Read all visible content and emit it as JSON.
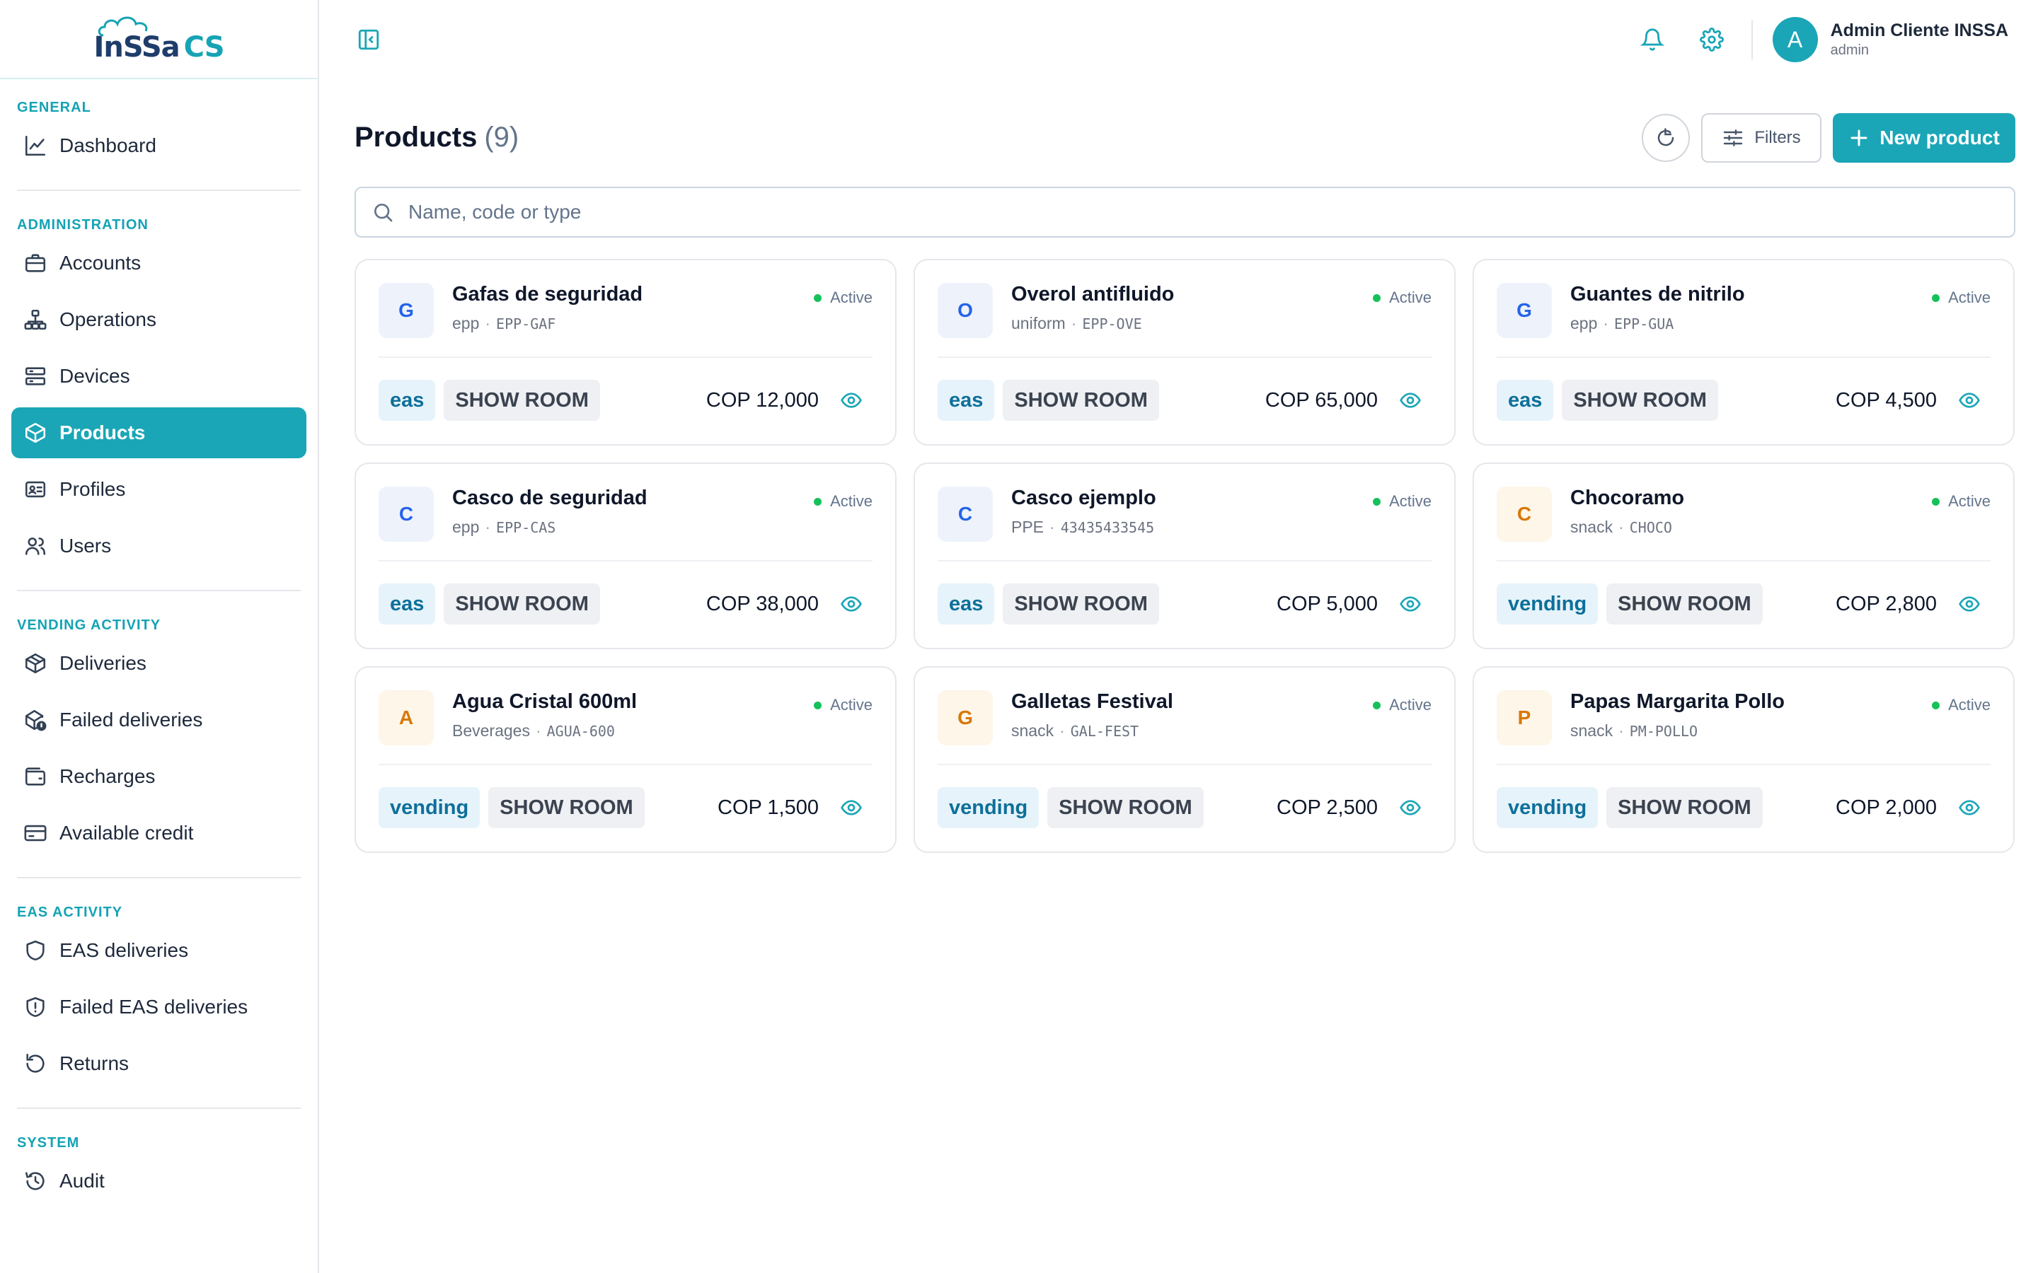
{
  "brand": {
    "logo_main": "InSSa",
    "logo_suffix": "CS"
  },
  "sidebar": {
    "sections": [
      {
        "title": "GENERAL",
        "items": [
          {
            "label": "Dashboard",
            "icon": "chart-line-icon",
            "active": false
          }
        ]
      },
      {
        "title": "ADMINISTRATION",
        "items": [
          {
            "label": "Accounts",
            "icon": "briefcase-icon",
            "active": false
          },
          {
            "label": "Operations",
            "icon": "network-icon",
            "active": false
          },
          {
            "label": "Devices",
            "icon": "server-icon",
            "active": false
          },
          {
            "label": "Products",
            "icon": "box-icon",
            "active": true
          },
          {
            "label": "Profiles",
            "icon": "id-card-icon",
            "active": false
          },
          {
            "label": "Users",
            "icon": "users-icon",
            "active": false
          }
        ]
      },
      {
        "title": "VENDING ACTIVITY",
        "items": [
          {
            "label": "Deliveries",
            "icon": "package-icon",
            "active": false
          },
          {
            "label": "Failed deliveries",
            "icon": "package-alert-icon",
            "active": false
          },
          {
            "label": "Recharges",
            "icon": "wallet-icon",
            "active": false
          },
          {
            "label": "Available credit",
            "icon": "credit-card-icon",
            "active": false
          }
        ]
      },
      {
        "title": "EAS ACTIVITY",
        "items": [
          {
            "label": "EAS deliveries",
            "icon": "shield-icon",
            "active": false
          },
          {
            "label": "Failed EAS deliveries",
            "icon": "shield-alert-icon",
            "active": false
          },
          {
            "label": "Returns",
            "icon": "undo-icon",
            "active": false
          }
        ]
      },
      {
        "title": "SYSTEM",
        "items": [
          {
            "label": "Audit",
            "icon": "history-icon",
            "active": false
          }
        ]
      }
    ]
  },
  "topbar": {
    "user": {
      "initial": "A",
      "name": "Admin Cliente INSSA",
      "role": "admin"
    }
  },
  "page": {
    "title": "Products",
    "count": "(9)",
    "filters_label": "Filters",
    "new_label": "New product",
    "search_placeholder": "Name, code or type"
  },
  "products": [
    {
      "letter": "G",
      "color": "blue",
      "name": "Gafas de seguridad",
      "category": "epp",
      "code": "EPP-GAF",
      "status": "Active",
      "type": "eas",
      "room": "SHOW ROOM",
      "price": "COP 12,000"
    },
    {
      "letter": "O",
      "color": "blue",
      "name": "Overol antifluido",
      "category": "uniform",
      "code": "EPP-OVE",
      "status": "Active",
      "type": "eas",
      "room": "SHOW ROOM",
      "price": "COP 65,000"
    },
    {
      "letter": "G",
      "color": "blue",
      "name": "Guantes de nitrilo",
      "category": "epp",
      "code": "EPP-GUA",
      "status": "Active",
      "type": "eas",
      "room": "SHOW ROOM",
      "price": "COP 4,500"
    },
    {
      "letter": "C",
      "color": "blue",
      "name": "Casco de seguridad",
      "category": "epp",
      "code": "EPP-CAS",
      "status": "Active",
      "type": "eas",
      "room": "SHOW ROOM",
      "price": "COP 38,000"
    },
    {
      "letter": "C",
      "color": "blue",
      "name": "Casco ejemplo",
      "category": "PPE",
      "code": "43435433545",
      "status": "Active",
      "type": "eas",
      "room": "SHOW ROOM",
      "price": "COP 5,000"
    },
    {
      "letter": "C",
      "color": "amber",
      "name": "Chocoramo",
      "category": "snack",
      "code": "CHOCO",
      "status": "Active",
      "type": "vending",
      "room": "SHOW ROOM",
      "price": "COP 2,800"
    },
    {
      "letter": "A",
      "color": "amber",
      "name": "Agua Cristal 600ml",
      "category": "Beverages",
      "code": "AGUA-600",
      "status": "Active",
      "type": "vending",
      "room": "SHOW ROOM",
      "price": "COP 1,500"
    },
    {
      "letter": "G",
      "color": "amber",
      "name": "Galletas Festival",
      "category": "snack",
      "code": "GAL-FEST",
      "status": "Active",
      "type": "vending",
      "room": "SHOW ROOM",
      "price": "COP 2,500"
    },
    {
      "letter": "P",
      "color": "amber",
      "name": "Papas Margarita Pollo",
      "category": "snack",
      "code": "PM-POLLO",
      "status": "Active",
      "type": "vending",
      "room": "SHOW ROOM",
      "price": "COP 2,000"
    }
  ],
  "colors": {
    "accent": "#1aa6b7",
    "status_active": "#16c15a",
    "eas_tag_bg": "#e6f3fa",
    "eas_tag_fg": "#0e6f9a"
  }
}
